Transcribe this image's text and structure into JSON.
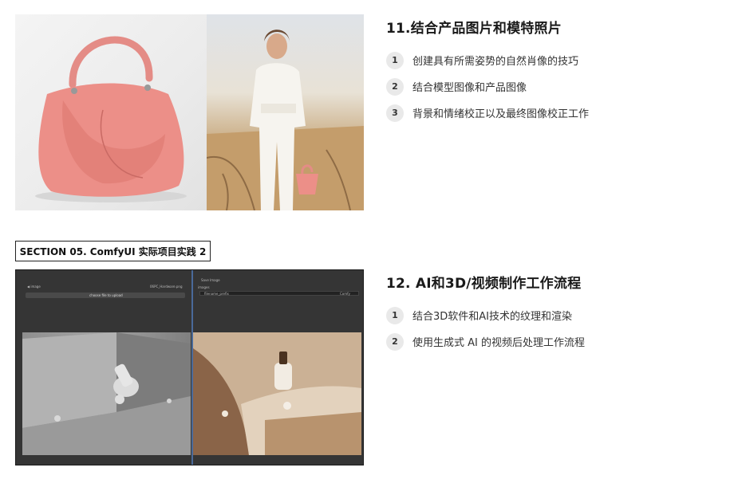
{
  "section11": {
    "title": "11.结合产品图片和模特照片",
    "items": [
      {
        "num": "1",
        "text": "创建具有所需姿势的自然肖像的技巧"
      },
      {
        "num": "2",
        "text": "结合模型图像和产品图像"
      },
      {
        "num": "3",
        "text": "背景和情绪校正以及最终图像校正工作"
      }
    ]
  },
  "section_label": "SECTION 05. ComfyUI 实际项目实践 2",
  "section12": {
    "title": "12. AI和3D/视频制作工作流程",
    "items": [
      {
        "num": "1",
        "text": "结合3D软件和AI技术的纹理和渲染"
      },
      {
        "num": "2",
        "text": "使用生成式 AI 的视频后处理工作流程"
      }
    ]
  },
  "comfy": {
    "left_tag": "◀ image",
    "file_tag": "06PC_Hardware.png",
    "upload": "choose file to upload",
    "right_title": "Save Image",
    "right_tag": "filename_prefix",
    "right_value": "Comfy",
    "images_tag": "images"
  }
}
